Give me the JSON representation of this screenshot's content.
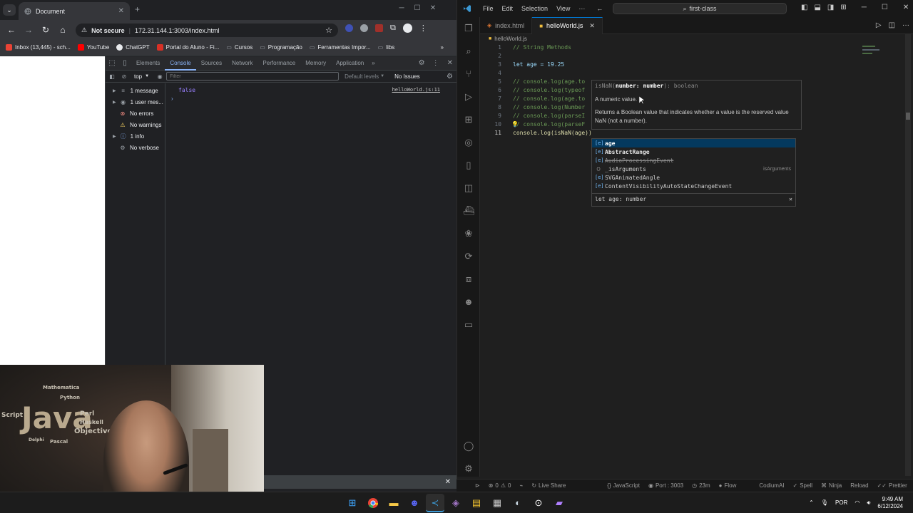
{
  "chrome": {
    "tab_title": "Document",
    "url": "172.31.144.1:3003/index.html",
    "security_label": "Not secure",
    "bookmarks": [
      {
        "label": "Inbox (13,445) - sch...",
        "color": "#ea4335"
      },
      {
        "label": "YouTube",
        "color": "#ff0000"
      },
      {
        "label": "ChatGPT",
        "color": "#e8eaed"
      },
      {
        "label": "Portal do Aluno - Fi...",
        "color": "#d93025"
      },
      {
        "label": "Cursos",
        "color": "#9aa0a6"
      },
      {
        "label": "Programação",
        "color": "#9aa0a6"
      },
      {
        "label": "Ferramentas Impor...",
        "color": "#9aa0a6"
      },
      {
        "label": "libs",
        "color": "#9aa0a6"
      }
    ]
  },
  "devtools": {
    "tabs": [
      "Elements",
      "Console",
      "Sources",
      "Network",
      "Performance",
      "Memory",
      "Application"
    ],
    "active_tab": "Console",
    "context": "top",
    "filter_placeholder": "Filter",
    "default_levels": "Default levels",
    "issues": "No Issues",
    "sidebar": [
      {
        "label": "1 message",
        "glyph": "≡",
        "color": "#e8eaed"
      },
      {
        "label": "1 user mes...",
        "glyph": "◉",
        "color": "#e8eaed"
      },
      {
        "label": "No errors",
        "glyph": "⊗",
        "color": "#f28b82"
      },
      {
        "label": "No warnings",
        "glyph": "⚠",
        "color": "#fdd663"
      },
      {
        "label": "1 info",
        "glyph": "ⓘ",
        "color": "#8ab4f8"
      },
      {
        "label": "No verbose",
        "glyph": "⚙",
        "color": "#9aa0a6"
      }
    ],
    "console_value": "false",
    "console_source": "helloWorld.js:11"
  },
  "webcam": {
    "words": [
      "Java",
      "Script",
      "Perl",
      "Haskell",
      "Objective",
      "Python",
      "Pascal",
      "Delphi",
      "Mathematica"
    ]
  },
  "vscode": {
    "menu": [
      "File",
      "Edit",
      "Selection",
      "View",
      "···"
    ],
    "search_label": "first-class",
    "tabs": [
      {
        "label": "index.html",
        "active": false
      },
      {
        "label": "helloWorld.js",
        "active": true
      }
    ],
    "breadcrumb": "helloWorld.js",
    "lines": [
      {
        "n": "1",
        "text": "// String Methods"
      },
      {
        "n": "2",
        "text": ""
      },
      {
        "n": "3",
        "text": "let age = 19.25"
      },
      {
        "n": "4",
        "text": ""
      },
      {
        "n": "5",
        "text": "// console.log(age.to"
      },
      {
        "n": "6",
        "text": "// console.log(typeof"
      },
      {
        "n": "7",
        "text": "// console.log(age.to"
      },
      {
        "n": "8",
        "text": "// console.log(Number"
      },
      {
        "n": "9",
        "text": "// console.log(parseI"
      },
      {
        "n": "10",
        "text": "// console.log(parseF"
      },
      {
        "n": "11",
        "text": "console.log(isNaN(age))"
      }
    ],
    "hover": {
      "signature_prefix": "isNaN(",
      "signature_param": "number: number",
      "signature_suffix": "): boolean",
      "param_doc": "A numeric value.",
      "description": "Returns a Boolean value that indicates whether a value is the reserved value NaN (not a number)."
    },
    "suggestions": [
      {
        "label": "age",
        "detail": ""
      },
      {
        "label": "AbstractRange",
        "detail": ""
      },
      {
        "label": "AudioProcessingEvent",
        "detail": ""
      },
      {
        "label": "_isArguments",
        "detail": "isArguments"
      },
      {
        "label": "SVGAnimatedAngle",
        "detail": ""
      },
      {
        "label": "ContentVisibilityAutoStateChangeEvent",
        "detail": ""
      }
    ],
    "suggest_footer": "let age: number",
    "status": {
      "errors": "0",
      "warnings": "0",
      "live_share": "Live Share",
      "language": "JavaScript",
      "port": "Port : 3003",
      "time": "23m",
      "flow": "Flow",
      "codium": "CodiumAI",
      "spell": "Spell",
      "ninja": "Ninja",
      "reload": "Reload",
      "prettier": "Prettier"
    }
  },
  "taskbar": {
    "lang": "POR",
    "time": "9:49 AM",
    "date": "6/12/2024"
  }
}
